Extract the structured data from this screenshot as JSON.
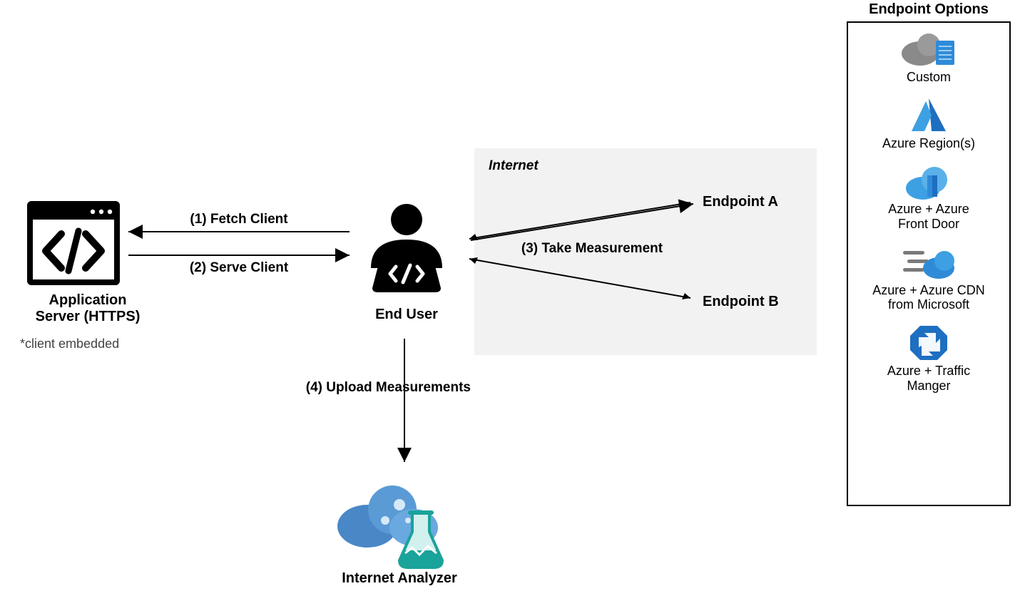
{
  "nodes": {
    "app_server": {
      "title": "Application\nServer (HTTPS)",
      "note": "*client embedded"
    },
    "end_user": {
      "title": "End User"
    },
    "internet": {
      "title": "Internet"
    },
    "endpoint_a": {
      "title": "Endpoint A"
    },
    "endpoint_b": {
      "title": "Endpoint B"
    },
    "internet_analyzer": {
      "title": "Internet Analyzer"
    }
  },
  "edges": {
    "fetch_client": "(1) Fetch Client",
    "serve_client": "(2) Serve Client",
    "take_measurement": "(3) Take Measurement",
    "upload_measurements": "(4) Upload Measurements"
  },
  "endpoint_options": {
    "title": "Endpoint Options",
    "items": [
      {
        "label": "Custom"
      },
      {
        "label": "Azure Region(s)"
      },
      {
        "label": "Azure + Azure\nFront Door"
      },
      {
        "label": "Azure + Azure CDN\nfrom Microsoft"
      },
      {
        "label": "Azure + Traffic\nManger"
      }
    ]
  }
}
